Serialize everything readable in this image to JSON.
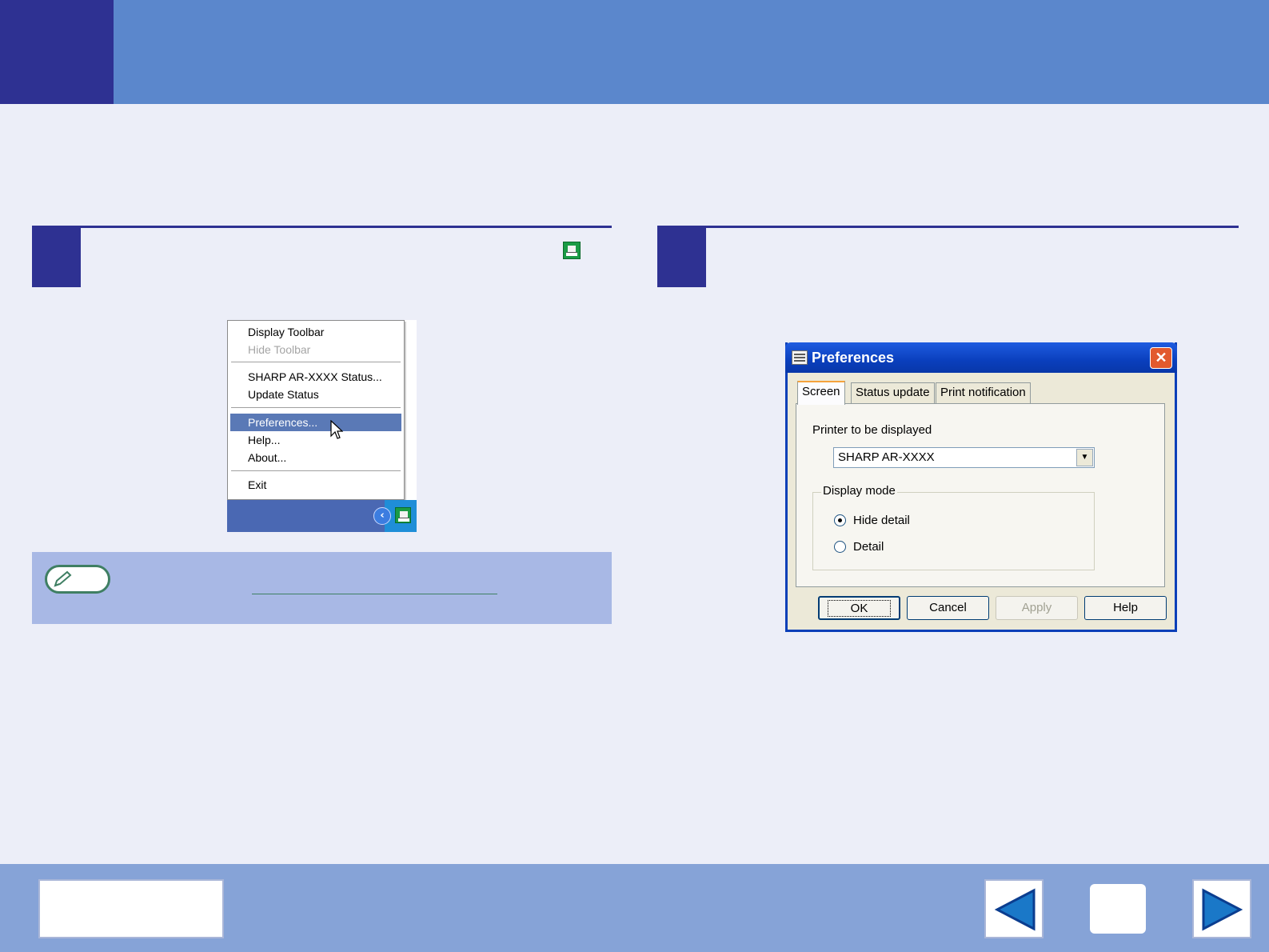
{
  "menu": {
    "items": [
      {
        "label": "Display Toolbar",
        "disabled": false,
        "selected": false
      },
      {
        "label": "Hide Toolbar",
        "disabled": true,
        "selected": false
      },
      {
        "label": "SHARP AR-XXXX Status...",
        "disabled": false,
        "selected": false
      },
      {
        "label": "Update Status",
        "disabled": false,
        "selected": false
      },
      {
        "label": "Preferences...",
        "disabled": false,
        "selected": true
      },
      {
        "label": "Help...",
        "disabled": false,
        "selected": false
      },
      {
        "label": "About...",
        "disabled": false,
        "selected": false
      },
      {
        "label": "Exit",
        "disabled": false,
        "selected": false
      }
    ]
  },
  "icons": {
    "tray": "printer-status-tray-icon",
    "chevron": "chevron-left-icon",
    "note": "pencil-icon",
    "dialog": "preferences-window-icon",
    "close": "close-icon",
    "prev": "arrow-left-icon",
    "next": "arrow-right-icon"
  },
  "dialog": {
    "title": "Preferences",
    "tabs": [
      "Screen",
      "Status update",
      "Print notification"
    ],
    "printer_label": "Printer to be displayed",
    "printer_value": "SHARP AR-XXXX",
    "display_mode_label": "Display mode",
    "radio_hide_detail": "Hide detail",
    "radio_detail": "Detail",
    "selected_mode": "Hide detail",
    "buttons": {
      "ok": "OK",
      "cancel": "Cancel",
      "apply": "Apply",
      "help": "Help"
    }
  },
  "colors": {
    "header": "#5b87cc",
    "accent": "#2e3192",
    "footer": "#86a3d7",
    "note": "#a8b8e5",
    "menu_selected": "#5a79b6"
  }
}
